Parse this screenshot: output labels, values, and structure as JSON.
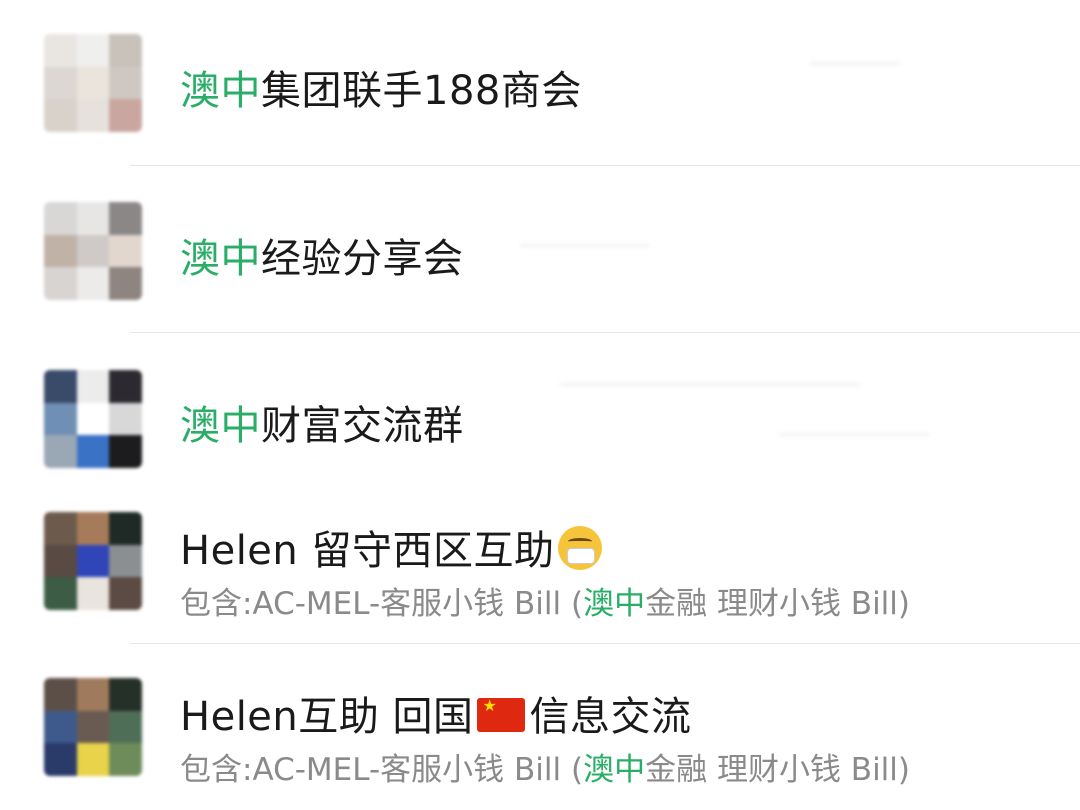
{
  "chats": [
    {
      "highlight": "澳中",
      "title_rest": "集团联手188商会",
      "subtitle": null,
      "avatar_colors": [
        "#e9e6e2",
        "#efefed",
        "#c8c2bb",
        "#dcd7d2",
        "#eae4dc",
        "#cfc8c2",
        "#d9d2cb",
        "#e6e1dc",
        "#c9a7a0"
      ]
    },
    {
      "highlight": "澳中",
      "title_rest": "经验分享会",
      "subtitle": null,
      "avatar_colors": [
        "#d9d7d6",
        "#e7e6e5",
        "#8b8786",
        "#c1b2a8",
        "#cfcac7",
        "#e2d7cf",
        "#d8d4d2",
        "#ecebea",
        "#8e8580"
      ]
    },
    {
      "highlight": "澳中",
      "title_rest": "财富交流群",
      "subtitle": null,
      "avatar_colors": [
        "#3a4b6a",
        "#ececec",
        "#2c2a30",
        "#6f8fb4",
        "#ffffff",
        "#d8d8d8",
        "#9aa7b5",
        "#3a72c5",
        "#1c1c1e"
      ]
    },
    {
      "title": "Helen 留守西区互助",
      "emoji": "mask-emoji",
      "subtitle_prefix": "包含:AC-MEL-客服小钱 Bill (",
      "subtitle_highlight": "澳中",
      "subtitle_suffix": "金融 理财小钱 Bill)",
      "avatar_colors": [
        "#6c5a4c",
        "#a67b5a",
        "#1f2a26",
        "#5a4a44",
        "#2f45b8",
        "#8b8f91",
        "#3c5c46",
        "#e9e4de",
        "#5b4b44"
      ]
    },
    {
      "title_prefix": "Helen互助 回国",
      "flag": "china-flag-icon",
      "title_suffix": "信息交流",
      "subtitle_prefix": "包含:AC-MEL-客服小钱 Bill (",
      "subtitle_highlight": "澳中",
      "subtitle_suffix": "金融 理财小钱 Bill)",
      "avatar_colors": [
        "#5c4f47",
        "#a07a5c",
        "#253028",
        "#3e5a8c",
        "#6a5b52",
        "#4f6e57",
        "#2a3b6a",
        "#e8d34a",
        "#6e8c5a"
      ]
    }
  ],
  "colors": {
    "highlight": "#2aae67",
    "title": "#1a1a1a",
    "subtitle": "#8a8a8a"
  }
}
